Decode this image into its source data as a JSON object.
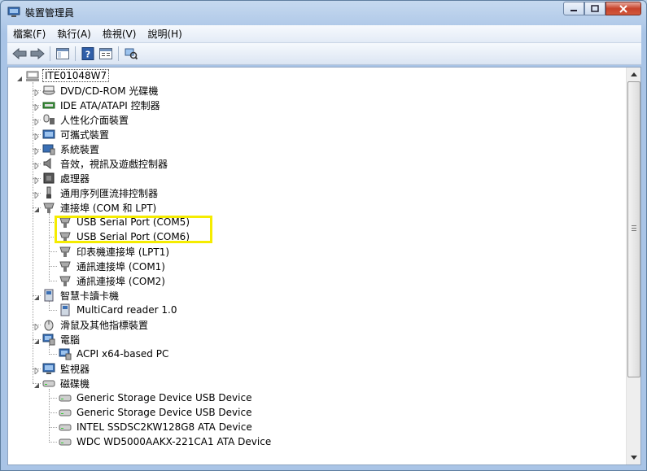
{
  "window": {
    "title": "裝置管理員"
  },
  "menu": [
    "檔案(F)",
    "執行(A)",
    "檢視(V)",
    "說明(H)"
  ],
  "toolbar": [
    "back-icon",
    "forward-icon",
    "show-hide-console-tree-icon",
    "help-icon",
    "properties-icon",
    "scan-hardware-icon"
  ],
  "tree": {
    "root": "ITE01048W7",
    "items": [
      {
        "label": "DVD/CD-ROM 光碟機",
        "icon": "dvd-icon",
        "level": 1,
        "expanded": false
      },
      {
        "label": "IDE ATA/ATAPI 控制器",
        "icon": "ide-controller-icon",
        "level": 1,
        "expanded": false
      },
      {
        "label": "人性化介面裝置",
        "icon": "hid-icon",
        "level": 1,
        "expanded": false
      },
      {
        "label": "可攜式裝置",
        "icon": "portable-device-icon",
        "level": 1,
        "expanded": false
      },
      {
        "label": "系統裝置",
        "icon": "system-device-icon",
        "level": 1,
        "expanded": false
      },
      {
        "label": "音效，視訊及遊戲控制器",
        "icon": "audio-icon",
        "level": 1,
        "expanded": false
      },
      {
        "label": "處理器",
        "icon": "processor-icon",
        "level": 1,
        "expanded": false
      },
      {
        "label": "通用序列匯流排控制器",
        "icon": "usb-controller-icon",
        "level": 1,
        "expanded": false
      },
      {
        "label": "連接埠 (COM 和 LPT)",
        "icon": "port-icon",
        "level": 1,
        "expanded": true
      },
      {
        "label": "USB Serial Port (COM5)",
        "icon": "port-icon",
        "level": 2
      },
      {
        "label": "USB Serial Port (COM6)",
        "icon": "port-icon",
        "level": 2
      },
      {
        "label": "印表機連接埠 (LPT1)",
        "icon": "port-icon",
        "level": 2
      },
      {
        "label": "通訊連接埠 (COM1)",
        "icon": "port-icon",
        "level": 2
      },
      {
        "label": "通訊連接埠 (COM2)",
        "icon": "port-icon",
        "level": 2
      },
      {
        "label": "智慧卡讀卡機",
        "icon": "smartcard-reader-icon",
        "level": 1,
        "expanded": true
      },
      {
        "label": "MultiCard reader 1.0",
        "icon": "smartcard-reader-icon",
        "level": 2
      },
      {
        "label": "滑鼠及其他指標裝置",
        "icon": "mouse-icon",
        "level": 1,
        "expanded": false
      },
      {
        "label": "電腦",
        "icon": "computer-icon",
        "level": 1,
        "expanded": true
      },
      {
        "label": "ACPI x64-based PC",
        "icon": "computer-icon",
        "level": 2
      },
      {
        "label": "監視器",
        "icon": "monitor-icon",
        "level": 1,
        "expanded": false
      },
      {
        "label": "磁碟機",
        "icon": "disk-drive-icon",
        "level": 1,
        "expanded": true
      },
      {
        "label": "Generic Storage Device USB Device",
        "icon": "disk-drive-icon",
        "level": 2
      },
      {
        "label": "Generic Storage Device USB Device",
        "icon": "disk-drive-icon",
        "level": 2
      },
      {
        "label": "INTEL SSDSC2KW128G8 ATA Device",
        "icon": "disk-drive-icon",
        "level": 2
      },
      {
        "label": "WDC WD5000AAKX-221CA1 ATA Device",
        "icon": "disk-drive-icon",
        "level": 2
      }
    ]
  },
  "colors": {
    "highlight": "#f5ec00",
    "titlebar": "#b9d1ea"
  }
}
